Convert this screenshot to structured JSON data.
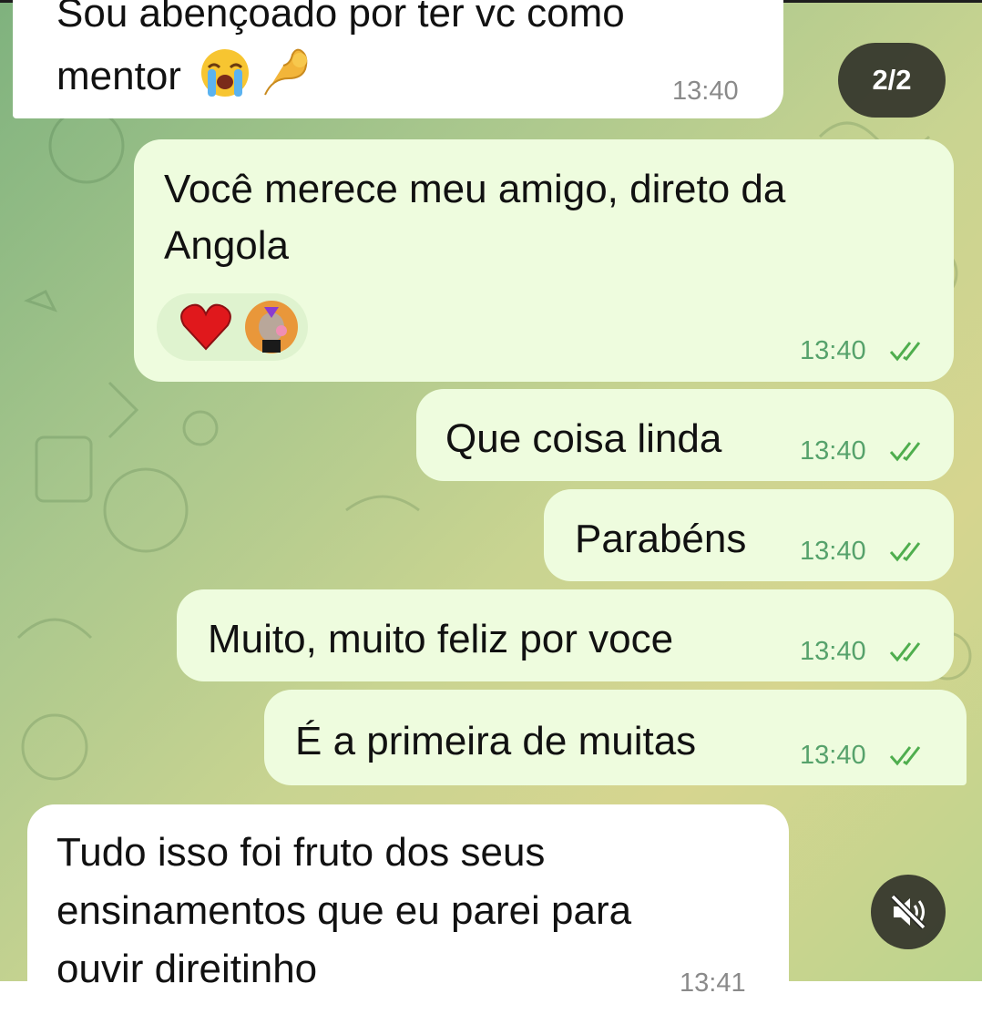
{
  "counter": "2/2",
  "messages": [
    {
      "direction": "incoming",
      "lines": [
        "Sou abençoado por ter vc como",
        "mentor"
      ],
      "emoji": [
        "loudly-crying-face",
        "pinching-hand"
      ],
      "time": "13:40"
    },
    {
      "direction": "outgoing",
      "lines": [
        "Você merece meu amigo, direto da",
        "Angola"
      ],
      "reactions": [
        "red-heart",
        "bored-ape-avatar"
      ],
      "time": "13:40",
      "status": "read"
    },
    {
      "direction": "outgoing",
      "lines": [
        "Que coisa linda"
      ],
      "time": "13:40",
      "status": "read"
    },
    {
      "direction": "outgoing",
      "lines": [
        "Parabéns"
      ],
      "time": "13:40",
      "status": "read"
    },
    {
      "direction": "outgoing",
      "lines": [
        "Muito, muito feliz por voce"
      ],
      "time": "13:40",
      "status": "read"
    },
    {
      "direction": "outgoing",
      "lines": [
        "É a primeira de muitas"
      ],
      "time": "13:40",
      "status": "read"
    },
    {
      "direction": "incoming",
      "lines": [
        "Tudo isso foi fruto dos seus",
        "ensinamentos que eu parei para",
        "ouvir direitinho"
      ],
      "time": "13:41"
    }
  ],
  "colors": {
    "outgoing_bubble": "#eefcde",
    "incoming_bubble": "#ffffff",
    "outgoing_time": "#56a26b",
    "read_ticks": "#4fae4e"
  },
  "icons": {
    "mute": "speaker-muted-icon",
    "read": "double-check-icon"
  }
}
